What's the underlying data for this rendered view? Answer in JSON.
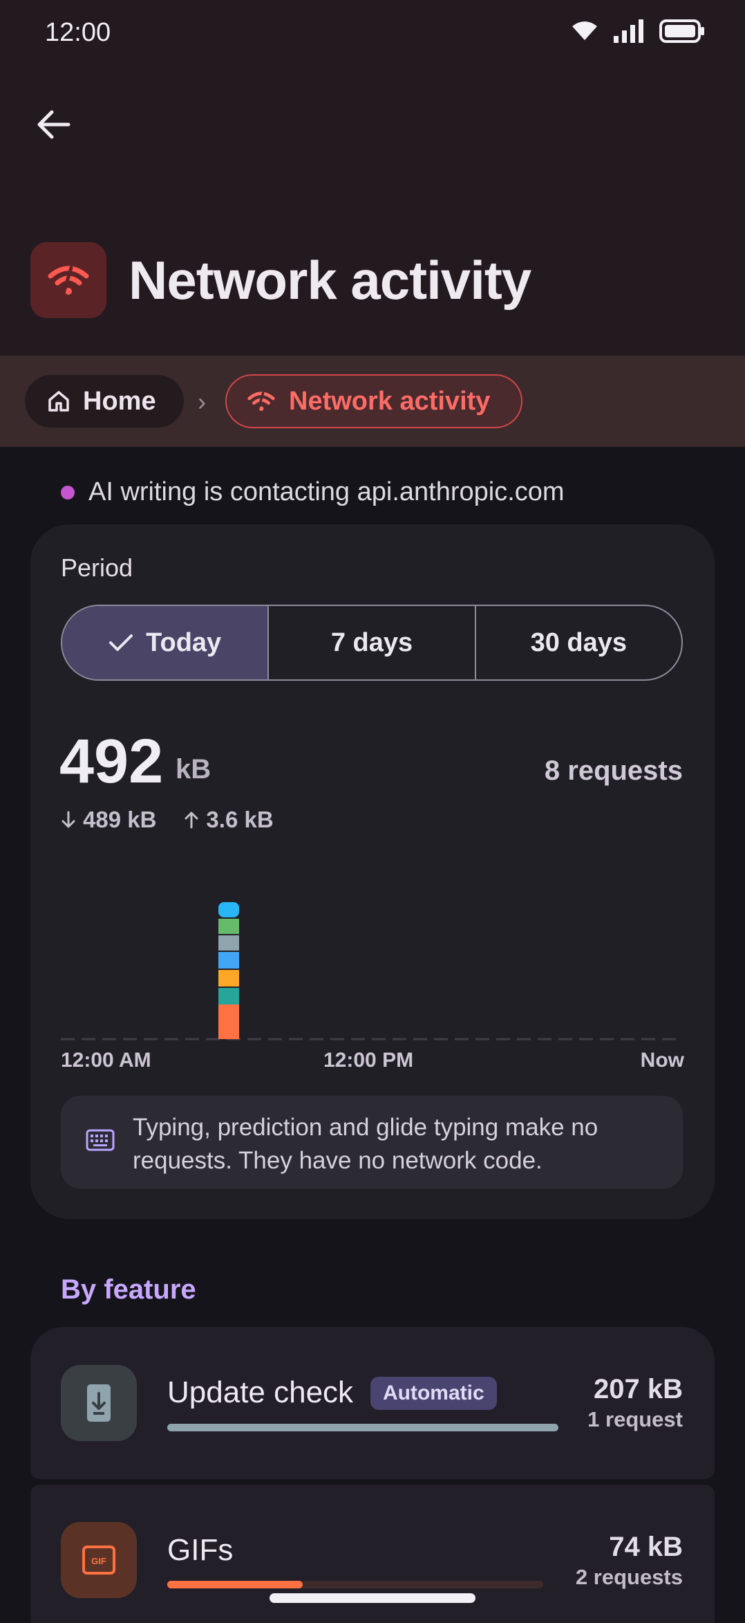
{
  "status_bar": {
    "time": "12:00"
  },
  "header": {
    "title": "Network activity"
  },
  "breadcrumb": {
    "home": "Home",
    "separator": "›",
    "current": "Network activity"
  },
  "activity_notice": "AI writing is contacting api.anthropic.com",
  "period": {
    "label": "Period",
    "options": [
      "Today",
      "7 days",
      "30 days"
    ],
    "selected": "Today"
  },
  "summary": {
    "total_value": "492",
    "total_unit": "kB",
    "requests": "8 requests",
    "download": "489 kB",
    "upload": "3.6 kB"
  },
  "chart_data": {
    "type": "bar",
    "x_ticks": [
      "12:00 AM",
      "12:00 PM",
      "Now"
    ],
    "stack_colors": [
      "#ff7043",
      "#26a69a",
      "#ffa726",
      "#42a5f5",
      "#90a4ae",
      "#66bb6a",
      "#29b6f6"
    ],
    "bar_position_fraction": 0.27,
    "segments_fraction_of_max": [
      0.25,
      0.13,
      0.13,
      0.13,
      0.12,
      0.12,
      0.12
    ]
  },
  "info": "Typing, prediction and glide typing make no requests. They have no network code.",
  "by_feature": {
    "title": "By feature",
    "items": [
      {
        "name": "Update check",
        "badge": "Automatic",
        "size": "207 kB",
        "requests": "1 request",
        "fraction": 1.0,
        "color": "#90a4ae"
      },
      {
        "name": "GIFs",
        "badge": "",
        "size": "74 kB",
        "requests": "2 requests",
        "fraction": 0.36,
        "color": "#ff7043"
      }
    ]
  },
  "colors": {
    "accent": "#ff6b66",
    "section": "#c8a8ff",
    "selected_segment": "#4a4566"
  }
}
